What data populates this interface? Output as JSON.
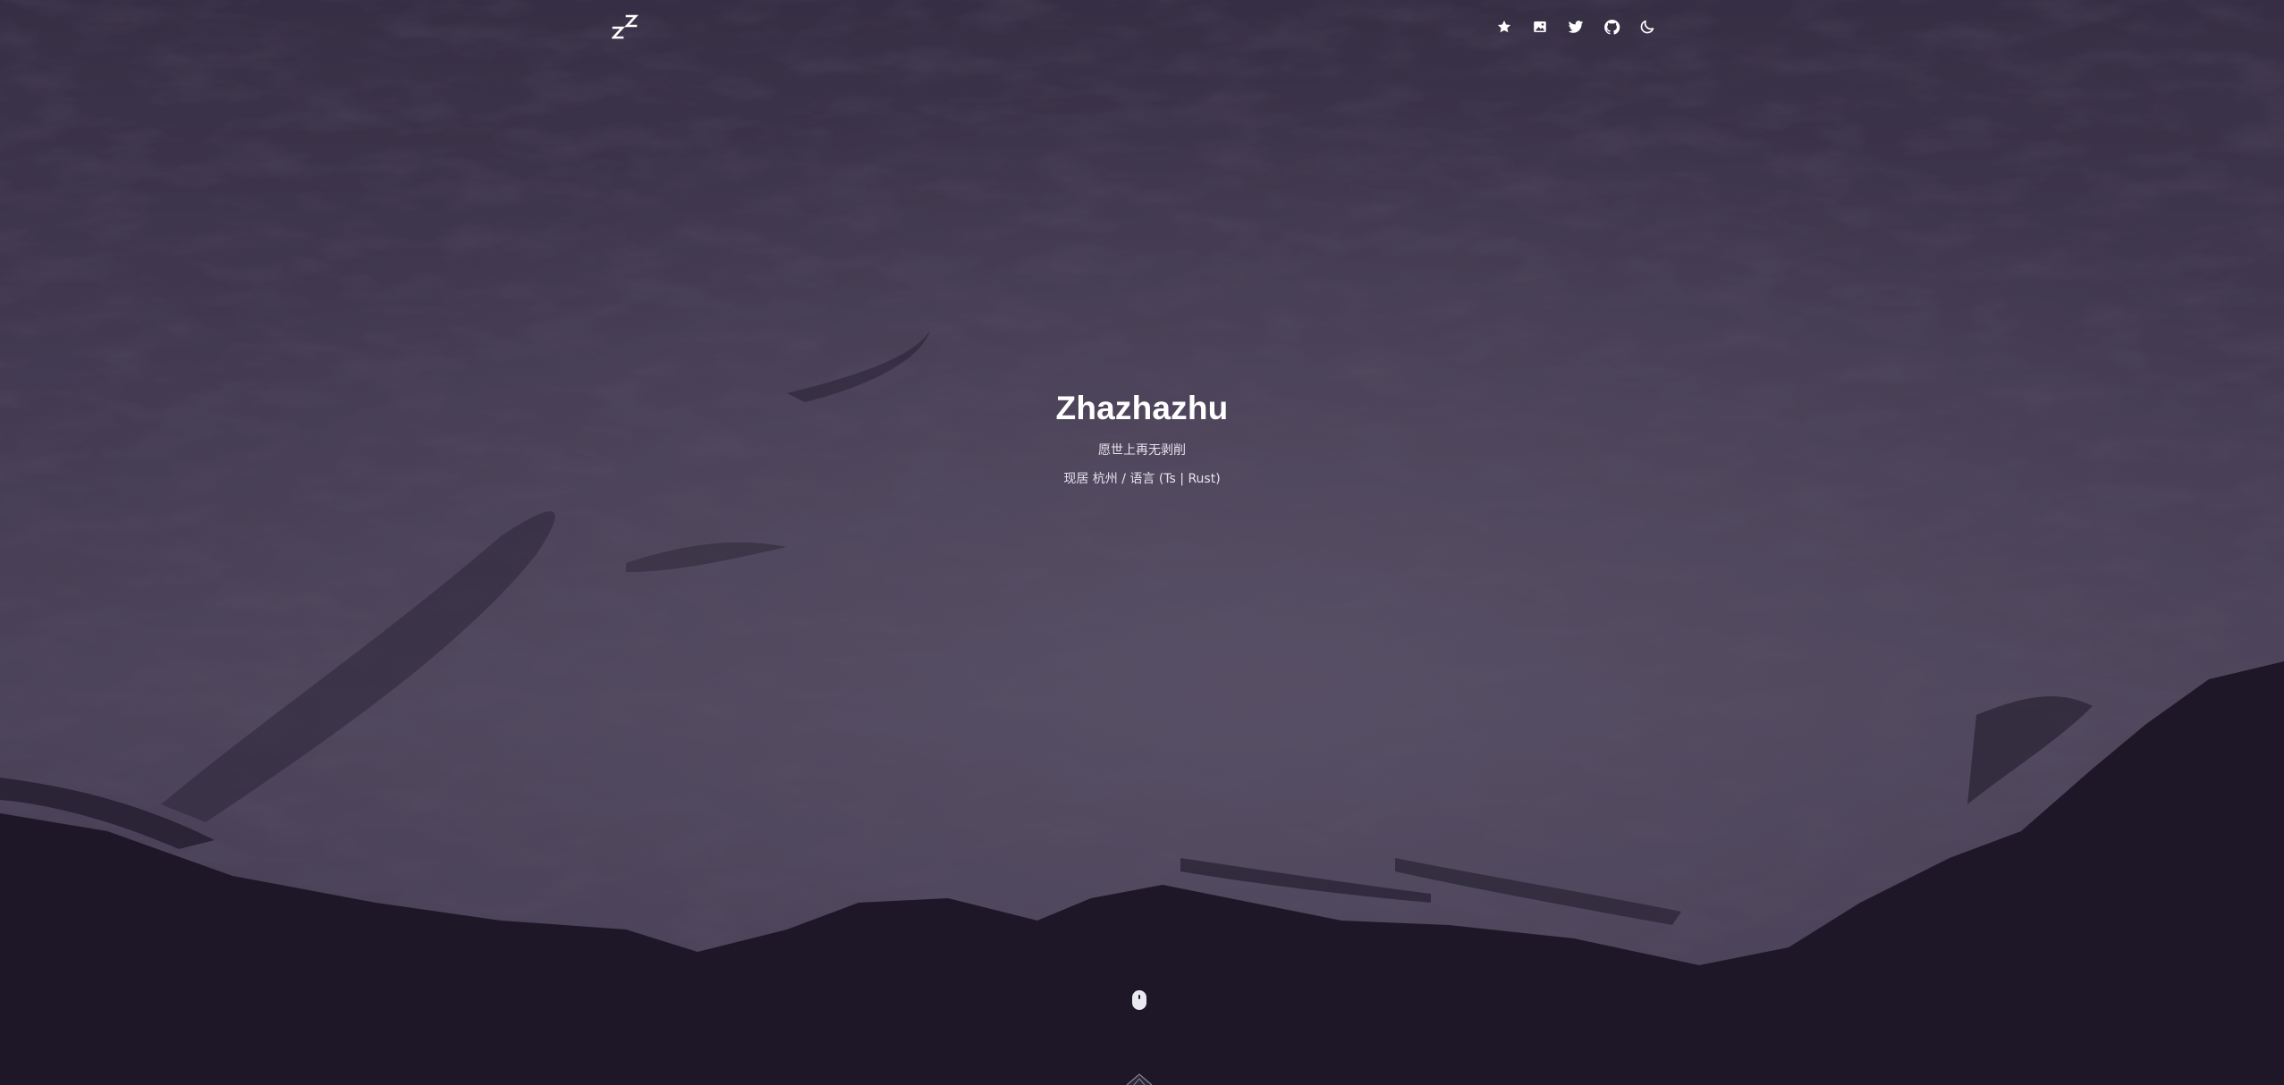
{
  "header": {
    "logo": {
      "icon": "zzz-logo-icon"
    },
    "nav": [
      {
        "icon": "star-icon"
      },
      {
        "icon": "image-icon"
      },
      {
        "icon": "twitter-icon"
      },
      {
        "icon": "github-icon"
      },
      {
        "icon": "moon-icon"
      }
    ]
  },
  "hero": {
    "title": "Zhazhazhu",
    "tagline": "愿世上再无剥削",
    "info": "现居 杭州 / 语言 (Ts | Rust)"
  },
  "scroll_hint": {
    "icon": "mouse-scroll-icon"
  },
  "footer": {
    "icon": "mountain-peak-icon"
  },
  "colors": {
    "background": "#1c1727",
    "sky": "#3f3850",
    "text": "#ffffff"
  }
}
